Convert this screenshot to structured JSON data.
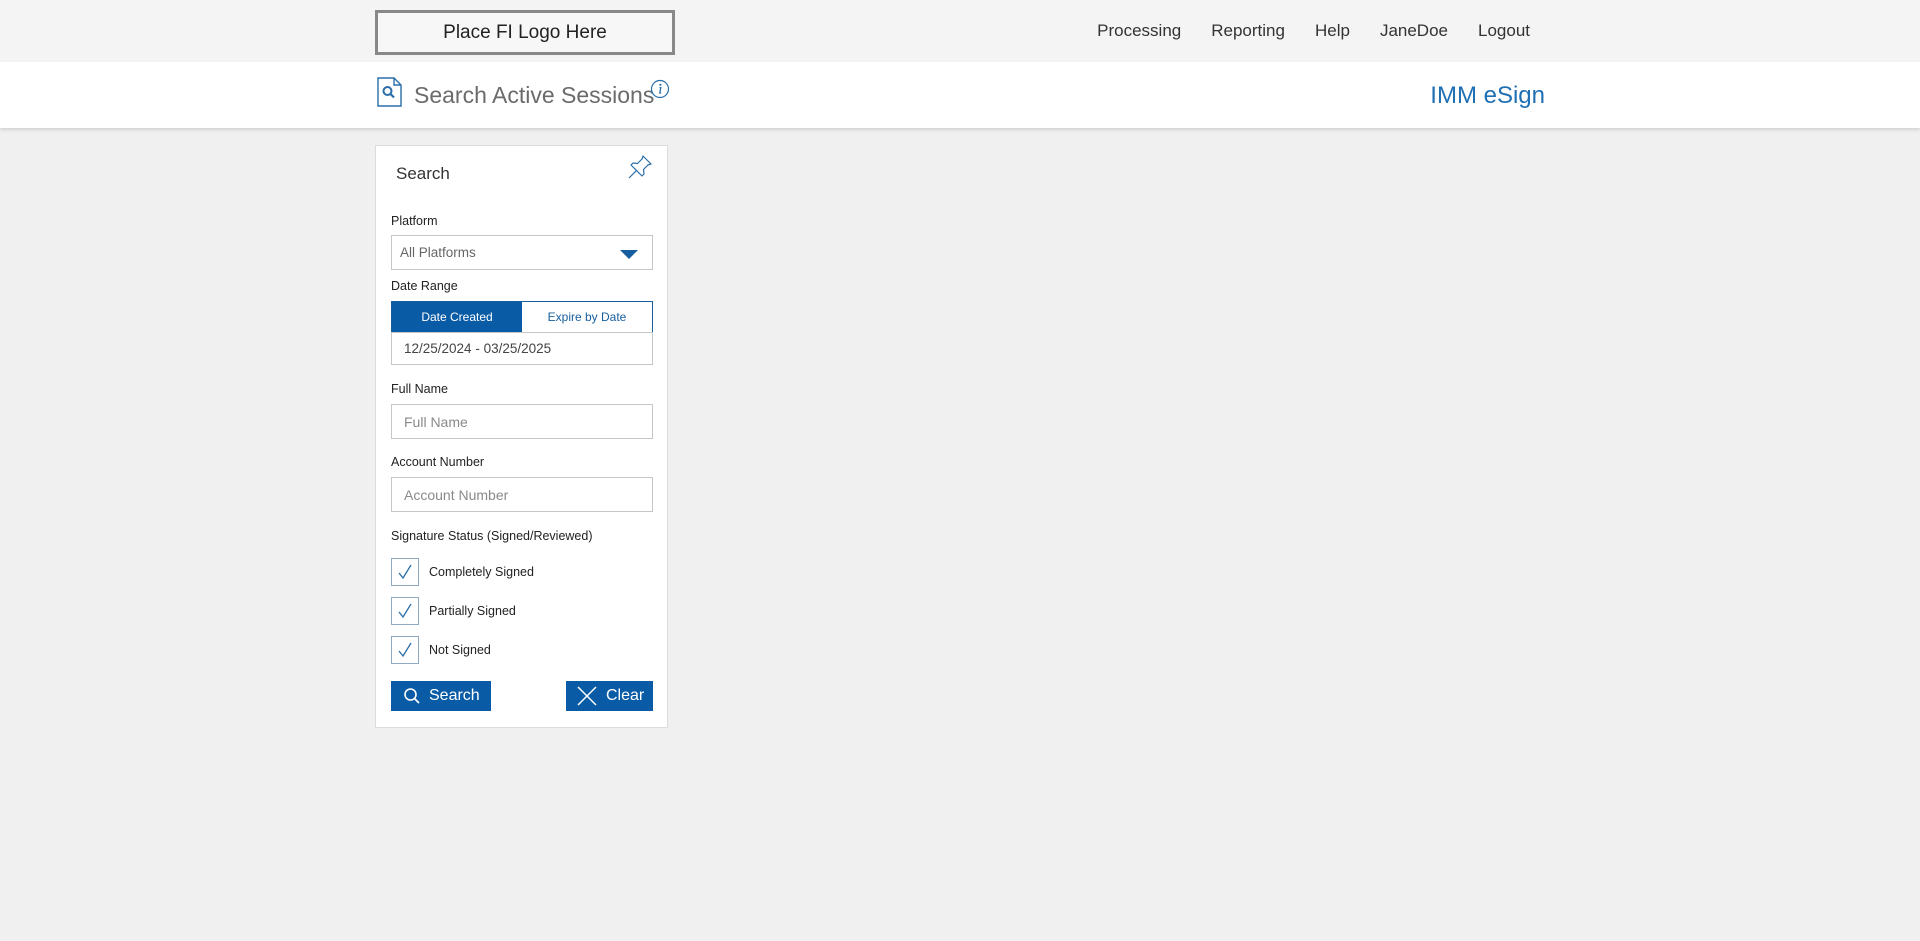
{
  "header": {
    "logo_text": "Place FI Logo Here",
    "nav": [
      "Processing",
      "Reporting",
      "Help",
      "JaneDoe",
      "Logout"
    ]
  },
  "subheader": {
    "title": "Search Active Sessions",
    "app_name": "IMM eSign"
  },
  "search_panel": {
    "title": "Search",
    "platform": {
      "label": "Platform",
      "value": "All Platforms"
    },
    "date_range": {
      "label": "Date Range",
      "options": [
        "Date Created",
        "Expire by Date"
      ],
      "selected": "Date Created",
      "value": "12/25/2024 - 03/25/2025"
    },
    "full_name": {
      "label": "Full Name",
      "placeholder": "Full Name",
      "value": ""
    },
    "account_number": {
      "label": "Account Number",
      "placeholder": "Account Number",
      "value": ""
    },
    "signature_status": {
      "label": "Signature Status (Signed/Reviewed)",
      "options": [
        {
          "label": "Completely Signed",
          "checked": true
        },
        {
          "label": "Partially Signed",
          "checked": true
        },
        {
          "label": "Not Signed",
          "checked": true
        }
      ]
    },
    "search_button": "Search",
    "clear_button": "Clear"
  },
  "colors": {
    "accent": "#0a5ba5",
    "app_name": "#1f6fb3",
    "background": "#f0f0f0"
  },
  "icons": {
    "page": "search-document-icon",
    "info": "info-icon",
    "pin": "pin-icon",
    "check": "checkmark-icon",
    "search": "magnifier-icon",
    "clear": "x-icon",
    "dropdown": "caret-down-icon"
  }
}
